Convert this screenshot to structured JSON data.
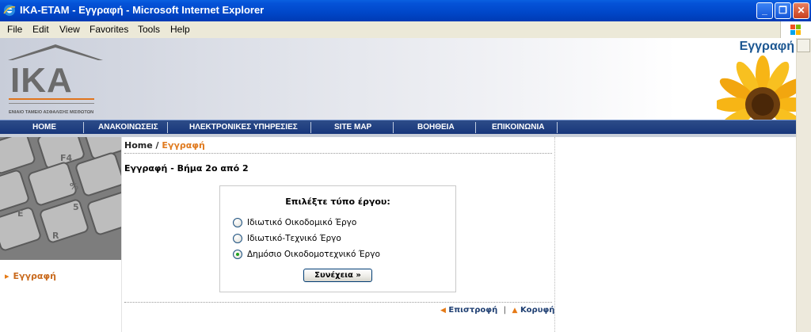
{
  "window": {
    "title": "IKA-ETAM - Εγγραφή - Microsoft Internet Explorer"
  },
  "menu": [
    "File",
    "Edit",
    "View",
    "Favorites",
    "Tools",
    "Help"
  ],
  "header": {
    "logo_text": "IKA",
    "logo_subtitle": "ΕΝΙΑΙΟ ΤΑΜΕΙΟ ΑΣΦΑΛΙΣΗΣ ΜΙΣΘΩΤΩΝ",
    "page_label": "Εγγραφή"
  },
  "nav": [
    "HOME",
    "ΑΝΑΚΟΙΝΩΣΕΙΣ",
    "ΗΛΕΚΤΡΟΝΙΚΕΣ ΥΠΗΡΕΣΙΕΣ",
    "SITE MAP",
    "ΒΟΗΘΕΙΑ",
    "ΕΠΙΚΟΙΝΩΝΙΑ"
  ],
  "sidebar": {
    "link": "Εγγραφή"
  },
  "breadcrumb": {
    "home": "Home",
    "separator": "/",
    "current": "Εγγραφή"
  },
  "step_title": "Εγγραφή - Βήμα 2ο από 2",
  "form": {
    "title": "Επιλέξτε τύπο έργου:",
    "options": [
      {
        "label": "Ιδιωτικό Οικοδομικό Έργο",
        "checked": false
      },
      {
        "label": "Ιδιωτικό-Τεχνικό Έργο",
        "checked": false
      },
      {
        "label": "Δημόσιο Οικοδομοτεχνικό Έργο",
        "checked": true
      }
    ],
    "continue_label": "Συνέχεια »"
  },
  "footer": {
    "back_label": "Επιστροφή",
    "top_label": "Κορυφή"
  },
  "colors": {
    "accent": "#e07a1e",
    "nav_bg": "#1f3f7f",
    "title_bar": "#0054e3"
  }
}
